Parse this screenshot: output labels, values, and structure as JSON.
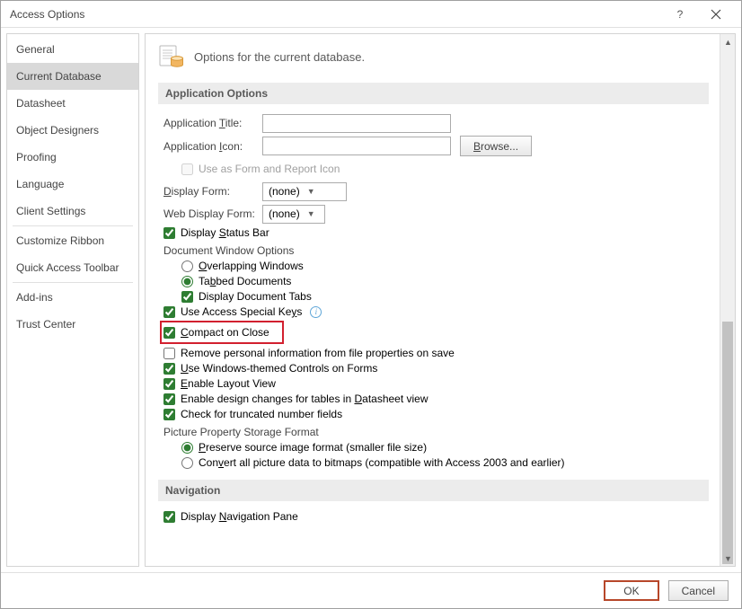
{
  "title": "Access Options",
  "sidebar": {
    "items": [
      "General",
      "Current Database",
      "Datasheet",
      "Object Designers",
      "Proofing",
      "Language",
      "Client Settings",
      "Customize Ribbon",
      "Quick Access Toolbar",
      "Add-ins",
      "Trust Center"
    ]
  },
  "heading": "Options for the current database.",
  "section_app": "Application Options",
  "app_title_lbl_pre": "Application ",
  "app_title_lbl_key": "T",
  "app_title_lbl_post": "itle:",
  "app_icon_lbl_pre": "Application ",
  "app_icon_lbl_key": "I",
  "app_icon_lbl_post": "con:",
  "browse_pre": "B",
  "browse_post": "rowse...",
  "use_as_form_icon": "Use as Form and Report Icon",
  "display_form_pre": "D",
  "display_form_post": "isplay Form:",
  "web_display_form": "Web Display Form:",
  "none": "(none)",
  "display_status_pre": "Display ",
  "display_status_key": "S",
  "display_status_post": "tatus Bar",
  "doc_window_options": "Document Window Options",
  "overlapping_key": "O",
  "overlapping_post": "verlapping Windows",
  "tabbed_pre": "Ta",
  "tabbed_key": "b",
  "tabbed_post": "bed Documents",
  "display_doc_tabs": "Display Document Tabs",
  "use_access_keys_pre": "Use Access Special Ke",
  "use_access_keys_key": "y",
  "use_access_keys_post": "s",
  "compact_key": "C",
  "compact_post": "ompact on Close",
  "remove_personal": "Remove personal information from file properties on save",
  "use_windows_pre": "U",
  "use_windows_post": "se Windows-themed Controls on Forms",
  "enable_layout_pre": "E",
  "enable_layout_post": "nable Layout View",
  "enable_design_pre": "Enable design changes for tables in ",
  "enable_design_key": "D",
  "enable_design_post": "atasheet view",
  "check_truncated": "Check for truncated number fields",
  "picture_storage": "Picture Property Storage Format",
  "preserve_key": "P",
  "preserve_post": "reserve source image format (smaller file size)",
  "convert_pre": "Con",
  "convert_key": "v",
  "convert_post": "ert all picture data to bitmaps (compatible with Access 2003 and earlier)",
  "section_nav": "Navigation",
  "display_nav_pre": "Display ",
  "display_nav_key": "N",
  "display_nav_post": "avigation Pane",
  "ok": "OK",
  "cancel": "Cancel"
}
